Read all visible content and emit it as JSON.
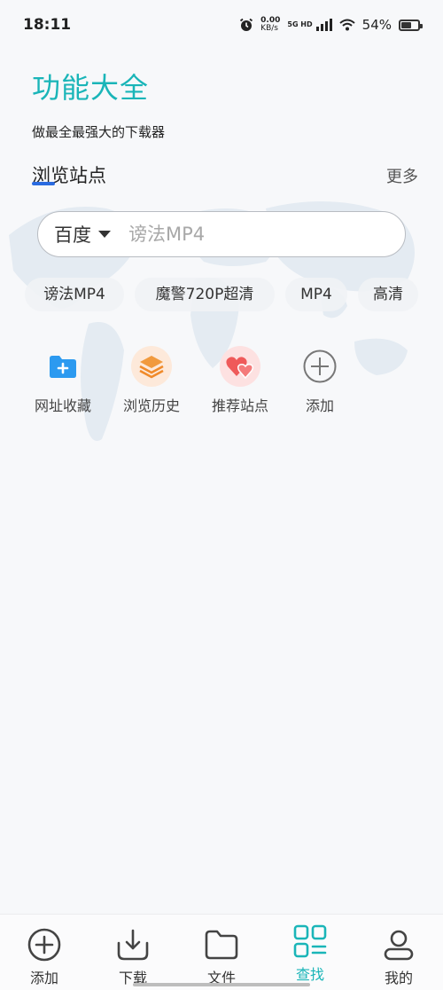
{
  "status_bar": {
    "time": "18:11",
    "net_speed": "0.00",
    "net_unit": "KB/s",
    "network_type": "5G HD",
    "battery": "54%",
    "icons": [
      "alarm-icon",
      "signal-icon",
      "wifi-icon",
      "battery-icon"
    ]
  },
  "header": {
    "title": "功能大全",
    "subtitle": "做最全最强大的下载器"
  },
  "browse_section": {
    "title": "浏览站点",
    "more": "更多"
  },
  "search": {
    "engine": "百度",
    "placeholder": "谤法MP4"
  },
  "chips": [
    "谤法MP4",
    "魔警720P超清",
    "MP4",
    "高清"
  ],
  "shortcuts": [
    {
      "label": "网址收藏",
      "icon": "bookmark-folder-icon"
    },
    {
      "label": "浏览历史",
      "icon": "history-layers-icon"
    },
    {
      "label": "推荐站点",
      "icon": "hearts-icon"
    },
    {
      "label": "添加",
      "icon": "plus-circle-icon"
    }
  ],
  "bottom_nav": [
    {
      "label": "添加",
      "icon": "add-circle-icon",
      "active": false
    },
    {
      "label": "下载",
      "icon": "download-icon",
      "active": false
    },
    {
      "label": "文件",
      "icon": "folder-icon",
      "active": false
    },
    {
      "label": "查找",
      "icon": "grid-search-icon",
      "active": true
    },
    {
      "label": "我的",
      "icon": "user-icon",
      "active": false
    }
  ],
  "colors": {
    "accent": "#1ab5b8",
    "underline": "#2a6be0",
    "background": "#f7f8fa"
  }
}
